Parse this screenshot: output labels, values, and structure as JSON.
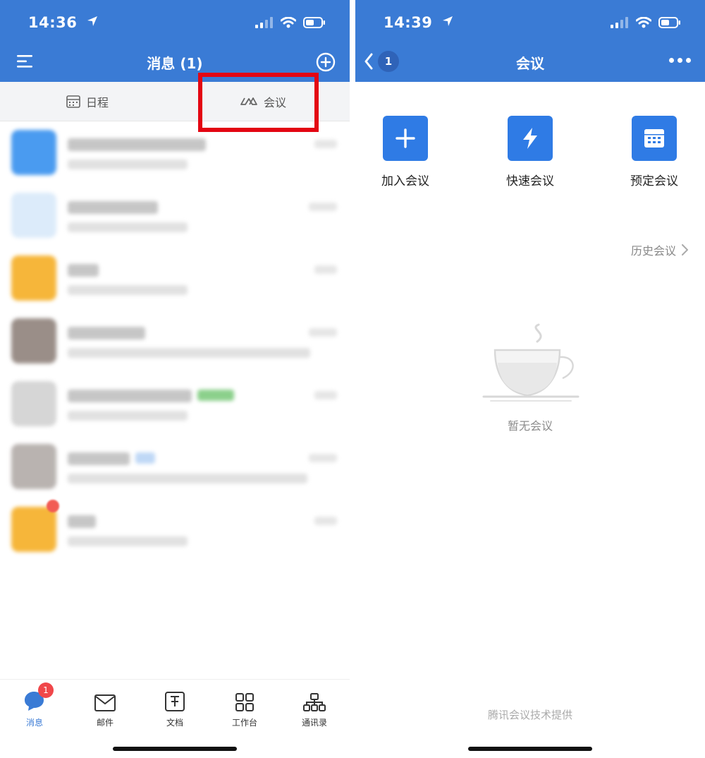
{
  "left": {
    "status": {
      "time": "14:36"
    },
    "nav": {
      "title": "消息 (1)"
    },
    "tabs": {
      "schedule": "日程",
      "meeting": "会议"
    },
    "messages": [
      {
        "avatar_color": "#4A9BF0",
        "title_w": 196,
        "title_color": "#C6C6C6"
      },
      {
        "avatar_color": "#DCEBFA",
        "title_w": 128,
        "title_color": "#C6C6C6"
      },
      {
        "avatar_color": "#F6B63A",
        "title_w": 44,
        "title_color": "#C6C6C6"
      },
      {
        "avatar_color": "#9A8E88",
        "title_w": 110,
        "title_color": "#C6C6C6"
      },
      {
        "avatar_color": "#D6D6D6",
        "title_w": 176,
        "title_color": "#C6C6C6",
        "tag_color": "#8BD08B"
      },
      {
        "avatar_color": "#B9B3B0",
        "title_w": 88,
        "title_color": "#C6C6C6",
        "tag_color": "#BFD8F6"
      },
      {
        "avatar_color": "#F6B63A",
        "title_w": 40,
        "title_color": "#C6C6C6"
      }
    ],
    "tabbar": {
      "messages": "消息",
      "messages_badge": "1",
      "mail": "邮件",
      "docs": "文档",
      "workbench": "工作台",
      "contacts": "通讯录"
    }
  },
  "right": {
    "status": {
      "time": "14:39"
    },
    "nav": {
      "title": "会议",
      "back_count": "1"
    },
    "actions": {
      "join": "加入会议",
      "quick": "快速会议",
      "schedule": "预定会议"
    },
    "history": "历史会议",
    "empty": "暂无会议",
    "footer": "腾讯会议技术提供"
  },
  "colors": {
    "header_blue": "#3A7BD5",
    "action_blue": "#2F7BE5",
    "highlight_red": "#E30613",
    "badge_red": "#F0474A"
  },
  "icons": [
    "menu-icon",
    "plus-circle-icon",
    "calendar-icon",
    "meeting-cloud-icon",
    "back-chevron-icon",
    "more-dots-icon",
    "plus-icon",
    "lightning-icon",
    "calendar-grid-icon",
    "chevron-right-icon",
    "coffee-cup-icon",
    "chat-bubble-icon",
    "mail-icon",
    "document-icon",
    "grid-icon",
    "org-chart-icon"
  ]
}
